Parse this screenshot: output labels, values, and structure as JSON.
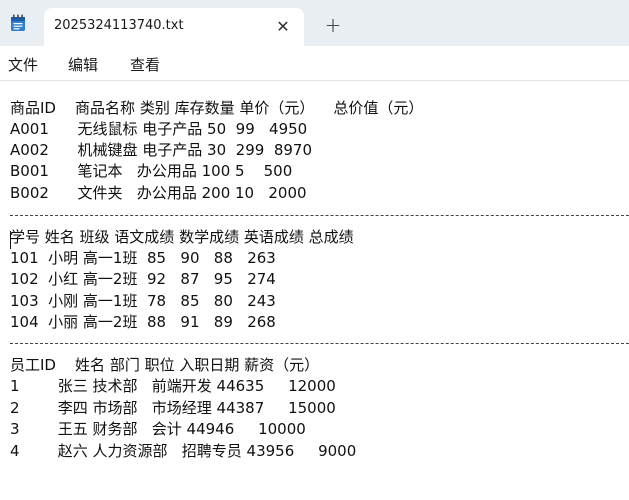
{
  "tab": {
    "title": "2025324113740.txt",
    "close_glyph": "✕",
    "new_tab_glyph": "+"
  },
  "menu": [
    "文件",
    "编辑",
    "查看"
  ],
  "lines": [
    "商品ID    商品名称 类别 库存数量 单价（元）    总价值（元）",
    "A001      无线鼠标 电子产品 50  99   4950",
    "A002      机械键盘 电子产品 30  299  8970",
    "B001      笔记本   办公用品 100 5    500",
    "B002      文件夹   办公用品 200 10   2000",
    "学号 姓名 班级 语文成绩 数学成绩 英语成绩 总成绩",
    "101  小明 高一1班  85   90   88   263",
    "102  小红 高一2班  92   87   95   274",
    "103  小刚 高一1班  78   85   80   243",
    "104  小丽 高一2班  88   91   89   268",
    "员工ID    姓名 部门 职位 入职日期 薪资（元）",
    "1        张三 技术部   前端开发 44635     12000",
    "2        李四 市场部   市场经理 44387     15000",
    "3        王五 财务部   会计 44946     10000",
    "4        赵六 人力资源部   招聘专员 43956     9000"
  ]
}
